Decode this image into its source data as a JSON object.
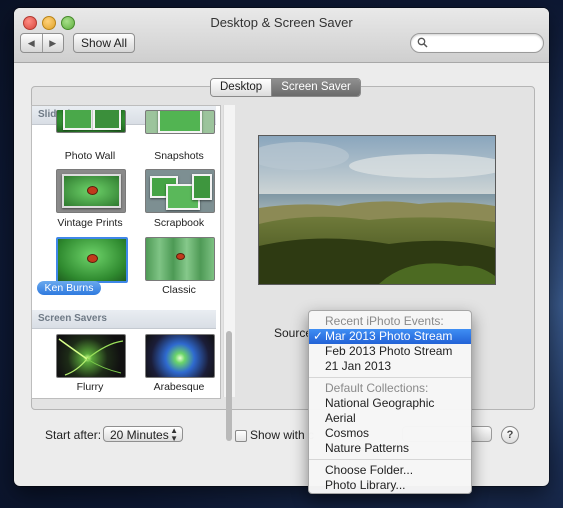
{
  "window": {
    "title": "Desktop & Screen Saver"
  },
  "toolbar": {
    "show_all_label": "Show All",
    "search_placeholder": ""
  },
  "tabs": [
    {
      "label": "Desktop",
      "selected": false
    },
    {
      "label": "Screen Saver",
      "selected": true
    }
  ],
  "sidebar": {
    "slideshows_header": "Slideshows",
    "slideshows": [
      {
        "label": "Photo Wall"
      },
      {
        "label": "Snapshots"
      },
      {
        "label": "Vintage Prints"
      },
      {
        "label": "Scrapbook"
      },
      {
        "label": "Ken Burns",
        "selected": true
      },
      {
        "label": "Classic"
      }
    ],
    "screen_savers_header": "Screen Savers",
    "screen_savers": [
      {
        "label": "Flurry"
      },
      {
        "label": "Arabesque"
      }
    ]
  },
  "source": {
    "label": "Source",
    "menu": {
      "recent_header": "Recent iPhoto Events:",
      "recent": [
        "Mar 2013 Photo Stream",
        "Feb 2013 Photo Stream",
        "21 Jan 2013"
      ],
      "selected": "Mar 2013 Photo Stream",
      "check_glyph": "✓",
      "defaults_header": "Default Collections:",
      "defaults": [
        "National Geographic",
        "Aerial",
        "Cosmos",
        "Nature Patterns"
      ],
      "actions": [
        "Choose Folder...",
        "Photo Library..."
      ]
    }
  },
  "footer": {
    "start_after_label": "Start after:",
    "start_after_value": "20 Minutes",
    "show_with_clock_label": "Show with c",
    "options_button_label": "",
    "help_label": "?"
  },
  "colors": {
    "accent": "#2f7adf",
    "selection": "#2262d6"
  }
}
